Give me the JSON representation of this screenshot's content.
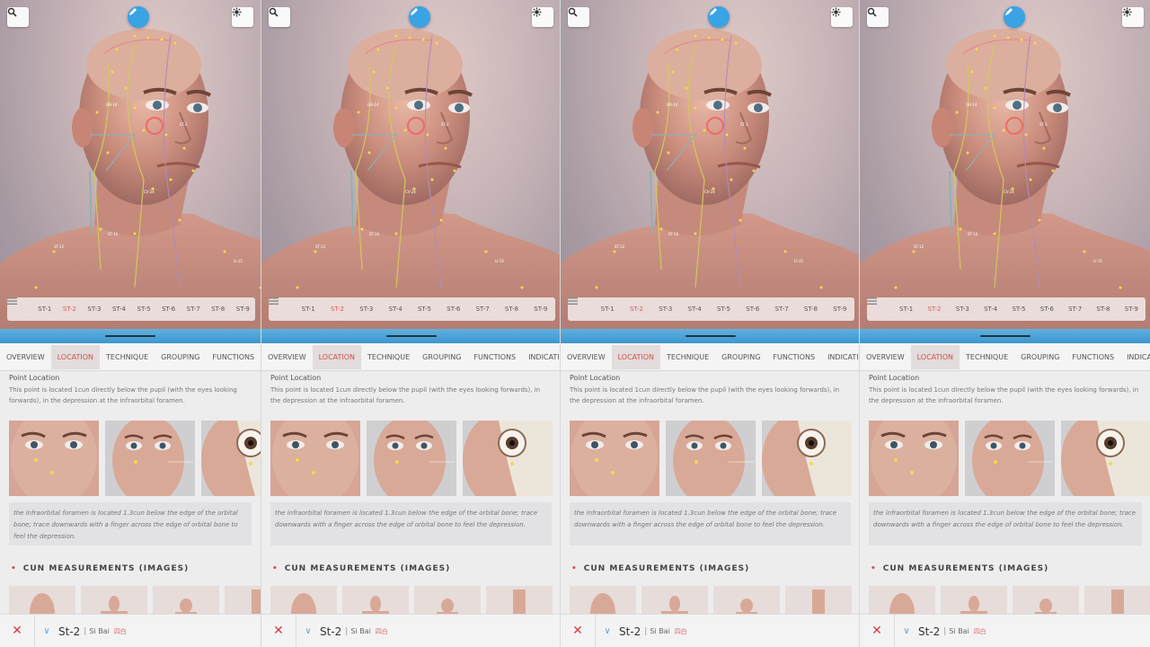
{
  "panels": [
    {
      "top_right_icon": "settings-icon"
    },
    {
      "top_right_icon": "settings-icon"
    },
    {
      "top_right_icon": "settings-icon"
    },
    {
      "top_right_icon": "settings-icon"
    }
  ],
  "toolbar": {
    "search_icon": "search-icon",
    "edit_icon": "pencil-icon",
    "menu_icon": "menu-icon"
  },
  "points": [
    "ST-1",
    "ST-2",
    "ST-3",
    "ST-4",
    "ST-5",
    "ST-6",
    "ST-7",
    "ST-8",
    "ST-9"
  ],
  "active_point_index": 1,
  "tabs": [
    "OVERVIEW",
    "LOCATION",
    "TECHNIQUE",
    "GROUPING",
    "FUNCTIONS",
    "INDICATIONS"
  ],
  "active_tab_index": 1,
  "location": {
    "section_title": "Point Location",
    "description": "This point is located 1cun directly below the pupil (with the eyes looking forwards), in the depression at the infraorbital foramen.",
    "note": "the infraorbital foramen is located 1.3cun below the edge of the orbital bone; trace downwards with a finger across the edge of orbital bone to feel the depression."
  },
  "cun_section": {
    "title": "CUN MEASUREMENTS (IMAGES)"
  },
  "bottom": {
    "point_name": "St-2",
    "separator": "|",
    "chinese_name": "Si Bai",
    "pinyin": "四白"
  },
  "colors": {
    "accent": "#d14f4f",
    "blue": "#3aa3e3"
  }
}
